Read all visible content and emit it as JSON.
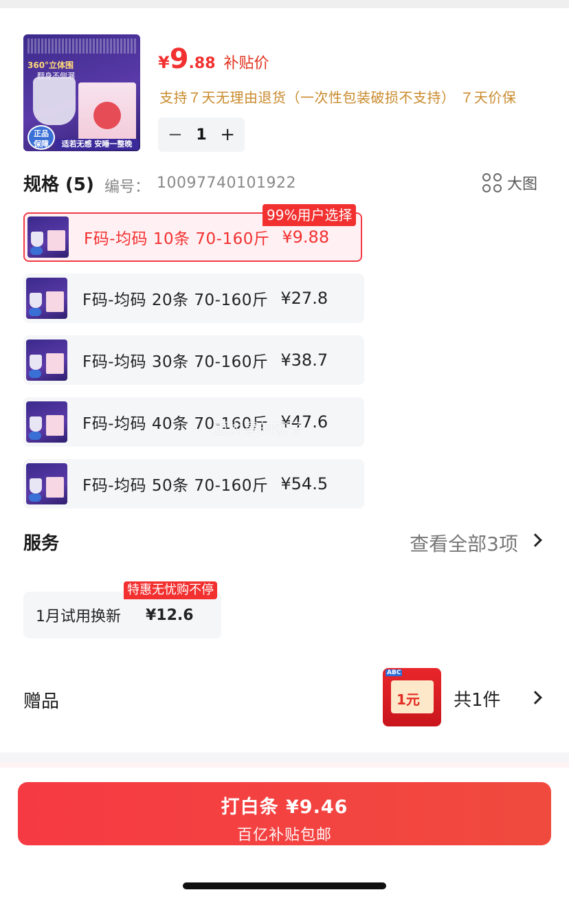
{
  "product": {
    "price_currency": "¥",
    "price_integer": "9",
    "price_decimal": ".88",
    "price_tag": "补贴价",
    "return_policy": "支持７天无理由退货（一次性包装破损不支持） ７天价保",
    "thumb_badge": "正品\n保障",
    "thumb_slogan": "适若无感 安睡一整晚",
    "thumb_header": "360°立体围",
    "thumb_header2": "翻身不侧漏"
  },
  "quantity": {
    "minus": "−",
    "value": "1",
    "plus": "+"
  },
  "spec": {
    "title": "规格 (5)",
    "code_label": "编号：",
    "code_value": "10097740101922",
    "big_view_label": "大图",
    "popular_tag": "99%用户选择",
    "options": [
      {
        "label": "F码-均码 10条 70-160斤",
        "price": "¥9.88"
      },
      {
        "label": "F码-均码 20条 70-160斤",
        "price": "¥27.8"
      },
      {
        "label": "F码-均码 30条 70-160斤",
        "price": "¥38.7"
      },
      {
        "label": "F码-均码 40条 70-160斤",
        "price": "¥47.6"
      },
      {
        "label": "F码-均码 50条 70-160斤",
        "price": "¥54.5"
      }
    ],
    "selected_index": 0
  },
  "watermark": "更为享的饮子",
  "services": {
    "title": "服务",
    "view_all": "查看全部3项",
    "tag": "特惠无忧购不停",
    "items": [
      {
        "name": "1月试用换新",
        "price": "¥12.6"
      }
    ]
  },
  "gifts": {
    "title": "赠品",
    "count_label": "共1件",
    "image_abc": "ABC",
    "image_text": "1元"
  },
  "buy": {
    "line1": "打白条 ¥9.46",
    "line2": "百亿补贴包邮"
  },
  "colors": {
    "accent": "#f23030",
    "policy": "#c98a2c",
    "card_bg": "#f5f6f8"
  }
}
